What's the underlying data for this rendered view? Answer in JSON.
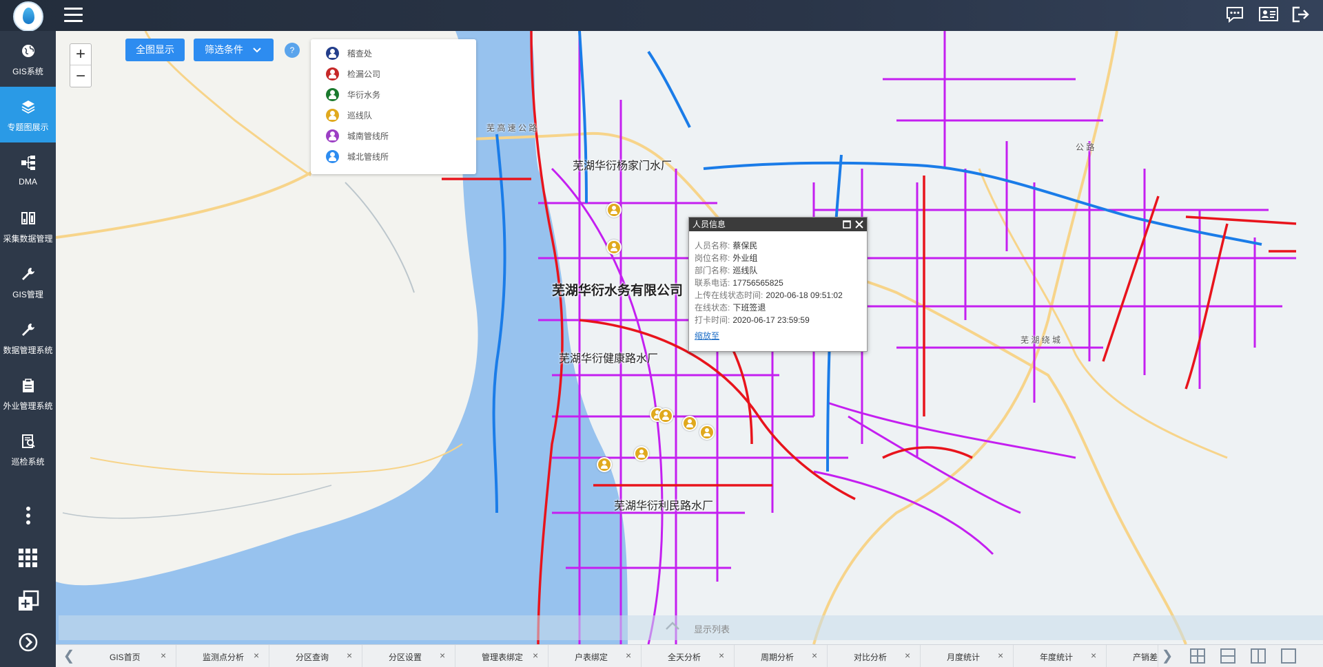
{
  "header": {
    "logo_icon": "water-drop-logo",
    "menu_icon": "hamburger-menu-icon",
    "right_icons": [
      "chat-icon",
      "id-card-icon",
      "logout-icon"
    ]
  },
  "sidebar": {
    "items": [
      {
        "label": "GIS系统",
        "icon": "globe-icon"
      },
      {
        "label": "专题图展示",
        "icon": "layers-icon",
        "active": true
      },
      {
        "label": "DMA",
        "icon": "network-icon"
      },
      {
        "label": "采集数据管理",
        "icon": "data-collect-icon"
      },
      {
        "label": "GIS管理",
        "icon": "wrench-icon"
      },
      {
        "label": "数据管理系统",
        "icon": "wrench-icon"
      },
      {
        "label": "外业管理系统",
        "icon": "clipboard-icon"
      },
      {
        "label": "巡检系统",
        "icon": "inspection-icon"
      }
    ],
    "tools": [
      "more-vertical-icon",
      "apps-grid-icon",
      "add-window-icon",
      "arrow-circle-right-icon"
    ]
  },
  "map": {
    "zoom_in": "+",
    "zoom_out": "−",
    "btn_full_view": "全图显示",
    "btn_filter": "筛选条件",
    "help": "?",
    "legend": [
      {
        "label": "稽查处",
        "color": "#233e8b"
      },
      {
        "label": "检漏公司",
        "color": "#c62828"
      },
      {
        "label": "华衍水务",
        "color": "#1b7a2e"
      },
      {
        "label": "巡线队",
        "color": "#e0a91e"
      },
      {
        "label": "城南管线所",
        "color": "#9c3fc4"
      },
      {
        "label": "城北管线所",
        "color": "#2d8cf0"
      }
    ],
    "labels": {
      "plant1": "芜湖华衍杨家门水厂",
      "company": "芜湖华衍水务有限公司",
      "plant2": "芜湖华衍健康路水厂",
      "plant3": "芜湖华衍利民路水厂",
      "road1": "芜 高 速 公 路",
      "road2": "公 路",
      "road3": "芜 湖 绕 城"
    },
    "list_toggle": "显示列表"
  },
  "popup": {
    "title": "人员信息",
    "rows": [
      {
        "k": "人员名称:",
        "v": "蔡保民"
      },
      {
        "k": "岗位名称:",
        "v": "外业组"
      },
      {
        "k": "部门名称:",
        "v": "巡线队"
      },
      {
        "k": "联系电话:",
        "v": "17756565825"
      },
      {
        "k": "上传在线状态时间:",
        "v": "2020-06-18 09:51:02"
      },
      {
        "k": "在线状态:",
        "v": "下班签退"
      },
      {
        "k": "打卡时间:",
        "v": "2020-06-17 23:59:59"
      }
    ],
    "link": "缩放至"
  },
  "tabs": [
    "GIS首页",
    "监测点分析",
    "分区查询",
    "分区设置",
    "管理表绑定",
    "户表绑定",
    "全天分析",
    "周期分析",
    "对比分析",
    "月度统计",
    "年度统计",
    "产销差"
  ],
  "tab_close": "×",
  "tab_prev": "❮",
  "tab_next": "❯"
}
